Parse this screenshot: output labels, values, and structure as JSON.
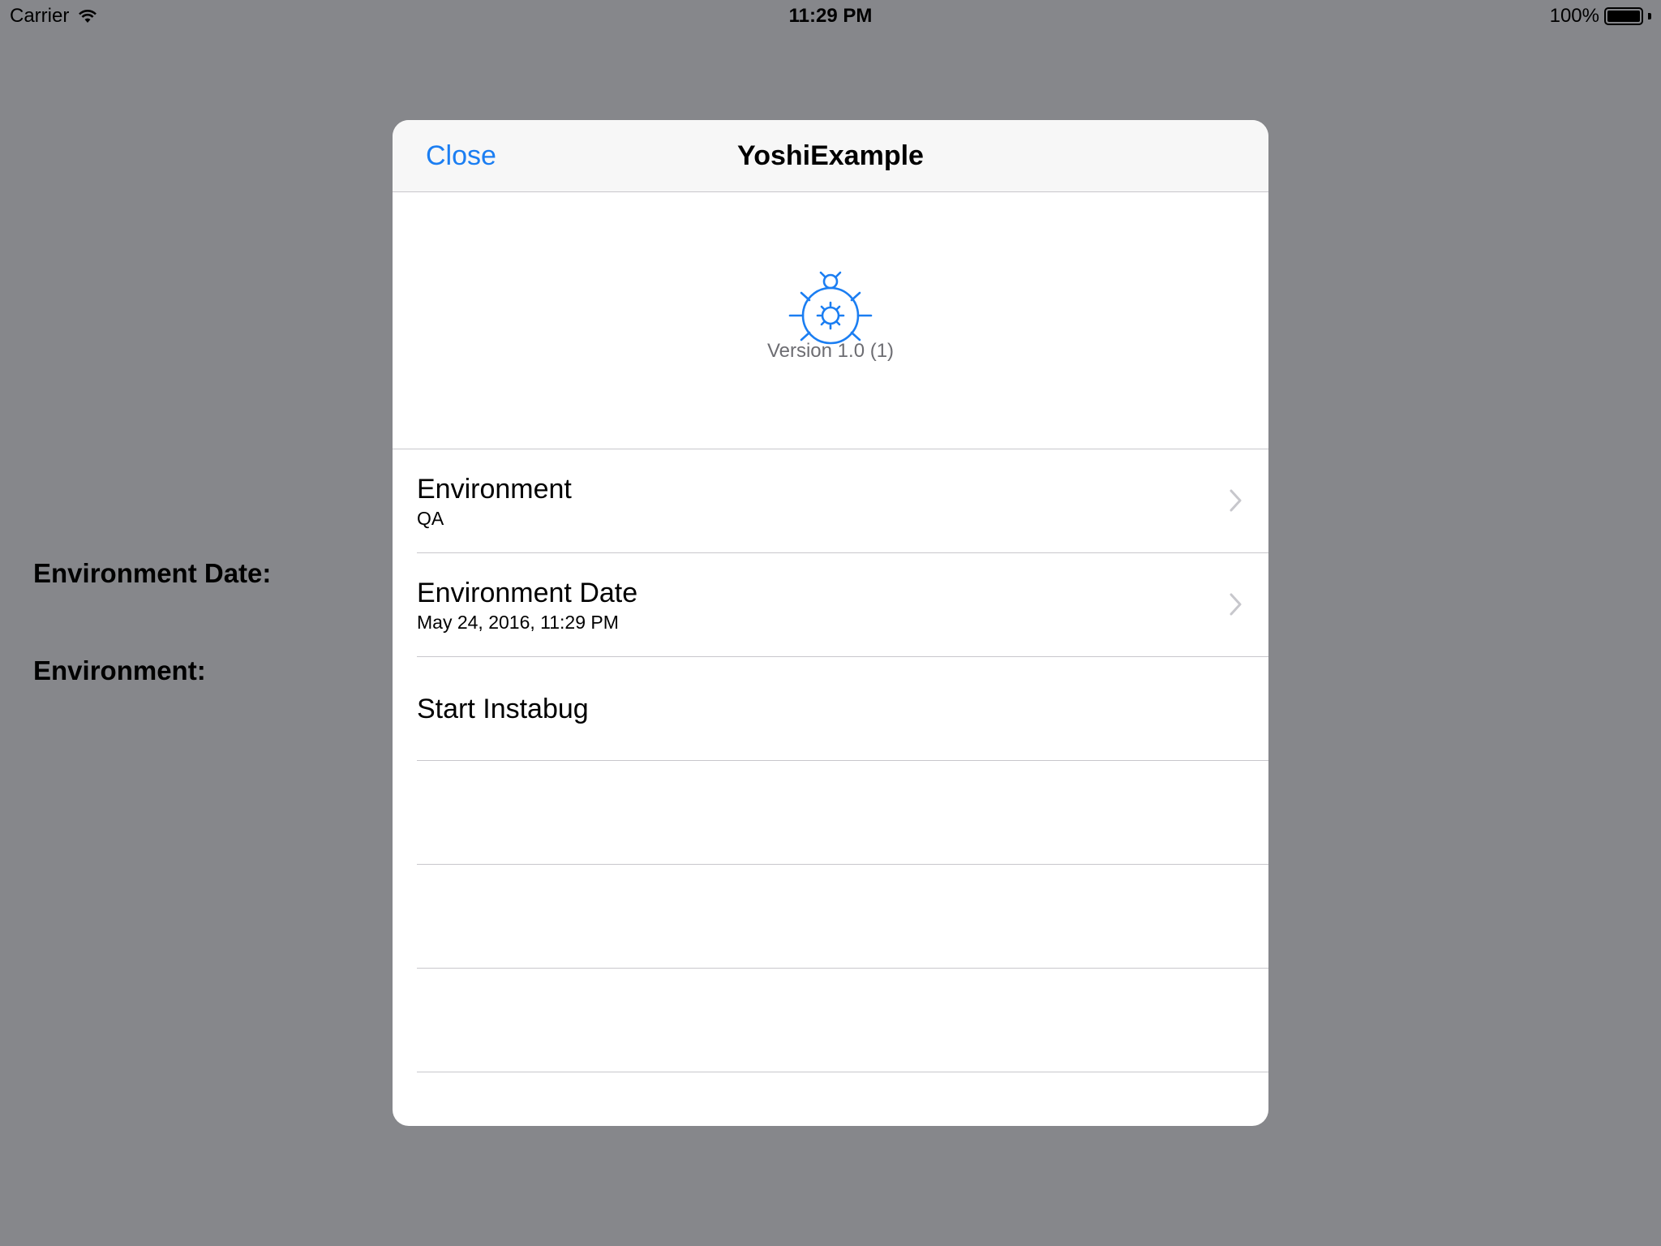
{
  "status_bar": {
    "carrier": "Carrier",
    "time": "11:29 PM",
    "battery": "100%",
    "battery_level": 1.0
  },
  "background": {
    "labels": [
      "Environment Date:",
      "Environment:"
    ]
  },
  "modal": {
    "close_label": "Close",
    "title": "YoshiExample",
    "icon": "bug-icon",
    "accent_color": "#1b7ef2",
    "version": "Version 1.0 (1)",
    "rows": [
      {
        "title": "Environment",
        "subtitle": "QA"
      },
      {
        "title": "Environment Date",
        "subtitle": "May 24, 2016, 11:29 PM"
      },
      {
        "title": "Start Instabug"
      }
    ]
  }
}
